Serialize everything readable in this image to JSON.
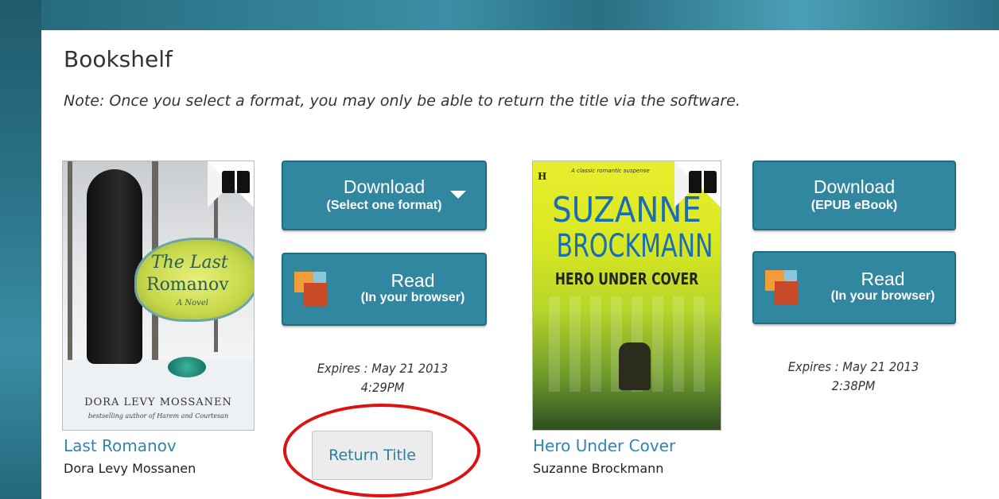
{
  "header": {
    "title": "Bookshelf",
    "note": "Note: Once you select a format, you may only be able to return the title via the software."
  },
  "books": [
    {
      "title": "Last Romanov",
      "author": "Dora Levy Mossanen",
      "cover": {
        "title_line1": "The Last",
        "title_line2": "Romanov",
        "subtitle": "A Novel",
        "author": "DORA LEVY MOSSANEN",
        "tagline": "bestselling author of Harem and Courtesan"
      },
      "download": {
        "label": "Download",
        "sub": "(Select one format)"
      },
      "read": {
        "label": "Read",
        "sub": "(In your browser)"
      },
      "expires_line1": "Expires : May 21 2013",
      "expires_line2": "4:29PM",
      "return_label": "Return Title"
    },
    {
      "title": "Hero Under Cover",
      "author": "Suzanne Brockmann",
      "cover": {
        "top_text": "A classic romantic suspense",
        "name1": "SUZANNE",
        "name2": "BROCKMANN",
        "title": "HERO UNDER COVER"
      },
      "download": {
        "label": "Download",
        "sub": "(EPUB eBook)"
      },
      "read": {
        "label": "Read",
        "sub": "(In your browser)"
      },
      "expires_line1": "Expires : May 21 2013",
      "expires_line2": "2:38PM"
    }
  ],
  "colors": {
    "button": "#3287a0",
    "link": "#2f86b0",
    "highlight": "#e01010"
  }
}
